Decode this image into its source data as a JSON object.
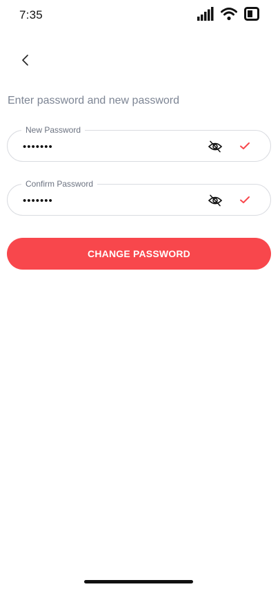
{
  "status_bar": {
    "time": "7:35",
    "icons": [
      "cellular-signal-icon",
      "wifi-icon",
      "battery-icon"
    ]
  },
  "header": {
    "back_icon": "chevron-left-icon"
  },
  "form": {
    "subtitle": "Enter password and new password",
    "new_password": {
      "label": "New Password",
      "value": "•••••••",
      "visibility_icon": "eye-off-icon",
      "status_icon": "check-icon"
    },
    "confirm_password": {
      "label": "Confirm Password",
      "value": "•••••••",
      "visibility_icon": "eye-off-icon",
      "status_icon": "check-icon"
    },
    "submit_label": "CHANGE PASSWORD"
  },
  "colors": {
    "accent": "#f8474c",
    "subtitle_text": "#7d8594",
    "field_border": "#d9dbe0"
  }
}
